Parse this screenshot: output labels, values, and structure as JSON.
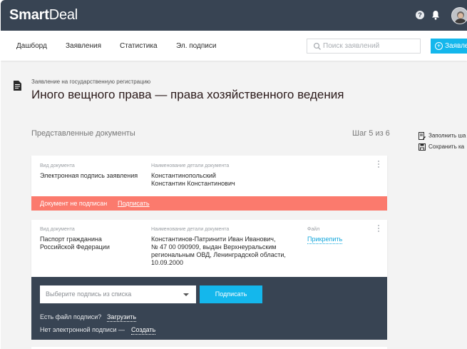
{
  "app": {
    "logo_bold": "Smart",
    "logo_light": "Deal",
    "help_symbol": "?"
  },
  "nav": {
    "items": [
      "Дашборд",
      "Заявления",
      "Статистика",
      "Эл. подписи"
    ],
    "search_placeholder": "Поиск заявлений",
    "new_button_label": "Заявле"
  },
  "header": {
    "subtitle": "Заявление на государственную регистрацию",
    "title": "Иного вещного права — права хозяйственного ведения"
  },
  "section": {
    "label": "Представленные документы",
    "step": "Шаг 5 из 6"
  },
  "side_actions": {
    "fill": "Заполнить ша",
    "save": "Сохранить ка"
  },
  "card1": {
    "doc_type_label": "Вид документа",
    "doc_type_value": "Электронная подпись заявления",
    "details_label": "Наименование детали документа",
    "details_lines": [
      "Константинопольский",
      "Константин Константинович"
    ],
    "warning_text": "Документ не подписан",
    "warning_action": "Подписать"
  },
  "card2": {
    "doc_type_label": "Вид документа",
    "doc_type_lines": [
      "Паспорт гражданина",
      "Российской Федерации"
    ],
    "details_label": "Наименование детали документа",
    "details_lines": [
      "Константинов-Патринити Иван Иванович,",
      "№ 47 00 090909, выдан Верхнеуральским",
      "региональным ОВД, Ленинградской области,",
      "10.09.2000"
    ],
    "file_label": "Файл",
    "file_action": "Прикрепить"
  },
  "signing": {
    "select_placeholder": "Выберите подпись из списка",
    "sign_button": "Подписать",
    "has_file_text": "Есть файл подписи?",
    "upload_link": "Загрузить",
    "no_signature_text": "Нет электронной подписи —",
    "create_link": "Создать"
  },
  "colors": {
    "topbar": "#384453",
    "accent": "#14b7ec",
    "warning": "#fb7a6d",
    "background": "#f3f3f3"
  }
}
